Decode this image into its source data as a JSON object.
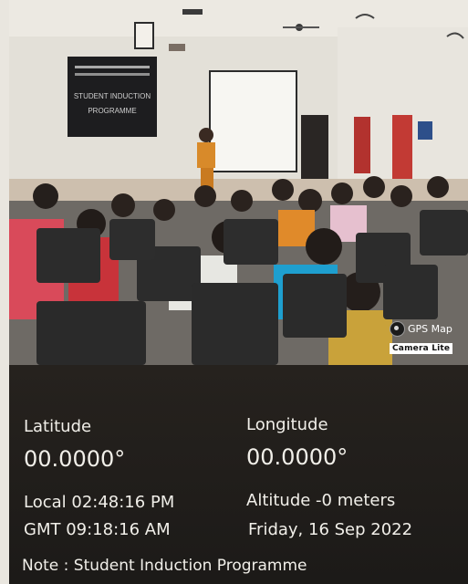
{
  "watermark": {
    "app_name": "GPS Map",
    "badge": "Camera Lite"
  },
  "location": {
    "latitude_label": "Latitude",
    "latitude_value": "00.0000°",
    "longitude_label": "Longitude",
    "longitude_value": "00.0000°",
    "local_time": "Local 02:48:16 PM",
    "gmt_time": "GMT 09:18:16 AM",
    "altitude": "Altitude -0 meters",
    "date": "Friday, 16 Sep 2022",
    "note": "Note : Student Induction Programme"
  },
  "photo": {
    "board_lines": [
      "STUDENT INDUCTION",
      "PROGRAMME"
    ]
  },
  "colors": {
    "panel_bg": "#1f1c19",
    "panel_text": "#f1efe9",
    "speaker_saree": "#d88a2a",
    "chair": "#2a2a2a"
  }
}
